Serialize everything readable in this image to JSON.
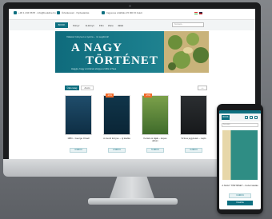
{
  "colors": {
    "brand": "#0e6f80",
    "accent": "#f06a2a",
    "background": "#6f7277"
  },
  "topbar": {
    "contacts": [
      {
        "icon": "phone-icon",
        "text": "+36 1 234 5678 · info@bookline.hu"
      },
      {
        "icon": "store-icon",
        "text": "Üzletkereső · Nyitvatartás"
      },
      {
        "icon": "truck-icon",
        "text": "Ingyenes szállítás 15 000 Ft felett"
      }
    ]
  },
  "nav": {
    "logo": "BOOK",
    "items": [
      "Könyv",
      "E-könyv",
      "Film",
      "Zene",
      "Játék"
    ],
    "search_placeholder": "Keresés..."
  },
  "hero": {
    "kicker": "Válassz könyvet a nyárra – mi segítünk!",
    "title_line1": "A NAGY",
    "title_line2": "TÖRTÉNET",
    "subtitle": "Hagyja, hogy a történet elvigye a Gifts of Sea"
  },
  "tabs": {
    "active": "Újdonság",
    "other": "Akció",
    "pager": "‹ ›"
  },
  "products": [
    {
      "title": "1984 – George Orwell",
      "tag": "",
      "price": "3 990 Ft"
    },
    {
      "title": "A csend könyve – új kiadás",
      "tag": "-20%",
      "price": "2 990 Ft"
    },
    {
      "title": "Kertek és tájak – képes album",
      "tag": "-15%",
      "price": "5 490 Ft"
    },
    {
      "title": "Színes jegyzetek – napló",
      "tag": "",
      "price": "3 290 Ft"
    }
  ],
  "phone": {
    "logo": "BOOK",
    "search_placeholder": "Keresés...",
    "product_title": "A NAGY TÖRTÉNET – Fehér kiadás",
    "price": "3 490 Ft",
    "cart_label": "Kosárba"
  }
}
